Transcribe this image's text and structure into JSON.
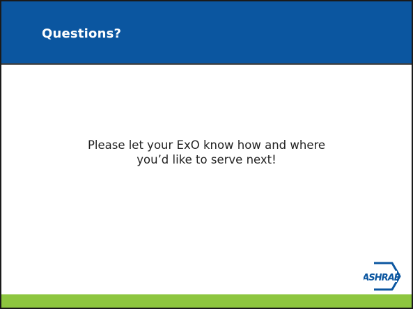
{
  "slide": {
    "title": "Questions?",
    "body_lines": [
      "Please let your ExO know how and where",
      "you’d like to serve next!"
    ],
    "logo": {
      "icon": "ashrae-logo-icon",
      "text": "ASHRAE"
    }
  },
  "colors": {
    "header_bg": "#0b56a0",
    "footer_bg": "#8dc63f",
    "logo_blue": "#0b56a0"
  }
}
